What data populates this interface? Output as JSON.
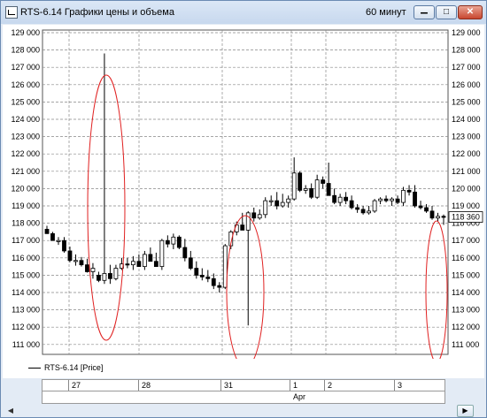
{
  "window": {
    "title": "RTS-6.14 Графики цены и объема",
    "interval": "60 минут",
    "buttons": {
      "minimize": "▁",
      "maximize": "□",
      "close": "✕"
    }
  },
  "colors": {
    "up": "#ffffff",
    "down": "#000000",
    "grid": "#888888",
    "annotation": "#e02020"
  },
  "legend": {
    "label": "RTS-6.14 [Price]"
  },
  "price_tag": "118 360",
  "date_axis": {
    "days": [
      "27",
      "28",
      "31",
      "1",
      "2",
      "3"
    ],
    "month": "Apr"
  },
  "chart_data": {
    "type": "candlestick",
    "y_axis_labels": [
      "129 000",
      "128 000",
      "127 000",
      "126 000",
      "125 000",
      "124 000",
      "123 000",
      "122 000",
      "121 000",
      "120 000",
      "119 000",
      "118 000",
      "117 000",
      "116 000",
      "115 000",
      "114 000",
      "113 000",
      "112 000",
      "111 000"
    ],
    "ylim": [
      110500,
      129300
    ],
    "grid": true,
    "last_price": 118360,
    "candles": [
      [
        117650,
        117850,
        117450,
        117400
      ],
      [
        117400,
        117500,
        117050,
        117000
      ],
      [
        117000,
        117200,
        116750,
        117000
      ],
      [
        117000,
        117200,
        116300,
        116400
      ],
      [
        116400,
        116650,
        115750,
        115850
      ],
      [
        115850,
        116200,
        115550,
        115850
      ],
      [
        115850,
        116050,
        115500,
        115600
      ],
      [
        115600,
        115950,
        115150,
        115200
      ],
      [
        115200,
        115700,
        114800,
        115400
      ],
      [
        115000,
        115200,
        114600,
        114700
      ],
      [
        114700,
        127800,
        114500,
        115100
      ],
      [
        115100,
        115600,
        114500,
        114800
      ],
      [
        114800,
        115600,
        114700,
        115400
      ],
      [
        115400,
        116000,
        115300,
        115650
      ],
      [
        115650,
        116000,
        115400,
        115600
      ],
      [
        115600,
        116100,
        115300,
        115800
      ],
      [
        115800,
        116200,
        115500,
        115500
      ],
      [
        115500,
        116400,
        115300,
        116200
      ],
      [
        116200,
        116600,
        115800,
        115800
      ],
      [
        115800,
        116300,
        115500,
        115500
      ],
      [
        115500,
        117100,
        115300,
        117000
      ],
      [
        117000,
        117300,
        116600,
        116800
      ],
      [
        116800,
        117400,
        116500,
        117200
      ],
      [
        117200,
        117300,
        116500,
        116600
      ],
      [
        116600,
        117100,
        115800,
        116000
      ],
      [
        116000,
        116400,
        115300,
        115400
      ],
      [
        115400,
        115800,
        114800,
        115000
      ],
      [
        115000,
        115400,
        114700,
        114900
      ],
      [
        114900,
        115300,
        114600,
        114800
      ],
      [
        114800,
        115100,
        114200,
        114400
      ],
      [
        114400,
        114600,
        114000,
        114300
      ],
      [
        114300,
        116800,
        114200,
        116700
      ],
      [
        116700,
        117600,
        116500,
        117500
      ],
      [
        117500,
        118100,
        117300,
        117900
      ],
      [
        117900,
        118600,
        117700,
        117600
      ],
      [
        117600,
        118700,
        112100,
        118600
      ],
      [
        118600,
        118900,
        118100,
        118300
      ],
      [
        118300,
        118800,
        118200,
        118500
      ],
      [
        118500,
        119500,
        118300,
        119300
      ],
      [
        119300,
        119600,
        119000,
        119300
      ],
      [
        119300,
        119800,
        118800,
        119000
      ],
      [
        119000,
        119700,
        118900,
        119200
      ],
      [
        119200,
        119600,
        118900,
        119400
      ],
      [
        119400,
        121800,
        119300,
        120900
      ],
      [
        120900,
        121000,
        119800,
        119900
      ],
      [
        119900,
        120200,
        119700,
        120000
      ],
      [
        120000,
        120300,
        119400,
        119500
      ],
      [
        119500,
        120800,
        119400,
        120500
      ],
      [
        120500,
        120700,
        120000,
        120300
      ],
      [
        120300,
        121500,
        119800,
        119600
      ],
      [
        119600,
        120000,
        119100,
        119200
      ],
      [
        119200,
        119700,
        119000,
        119500
      ],
      [
        119500,
        119800,
        119100,
        119300
      ],
      [
        119300,
        119600,
        118800,
        118900
      ],
      [
        118900,
        119100,
        118600,
        118800
      ],
      [
        118800,
        119000,
        118500,
        118600
      ],
      [
        118600,
        119000,
        118500,
        118700
      ],
      [
        118700,
        119400,
        118600,
        119300
      ],
      [
        119300,
        119500,
        119100,
        119400
      ],
      [
        119400,
        119600,
        119200,
        119300
      ],
      [
        119300,
        119500,
        119000,
        119400
      ],
      [
        119400,
        119600,
        119100,
        119200
      ],
      [
        119200,
        120100,
        119000,
        119900
      ],
      [
        119900,
        120200,
        119600,
        119800
      ],
      [
        119800,
        120200,
        118900,
        119000
      ],
      [
        119000,
        119300,
        118800,
        118900
      ],
      [
        118900,
        119100,
        118600,
        118700
      ],
      [
        118700,
        119000,
        118200,
        118300
      ],
      [
        118300,
        118600,
        118100,
        118400
      ],
      [
        118400,
        118500,
        117900,
        118360
      ]
    ]
  }
}
